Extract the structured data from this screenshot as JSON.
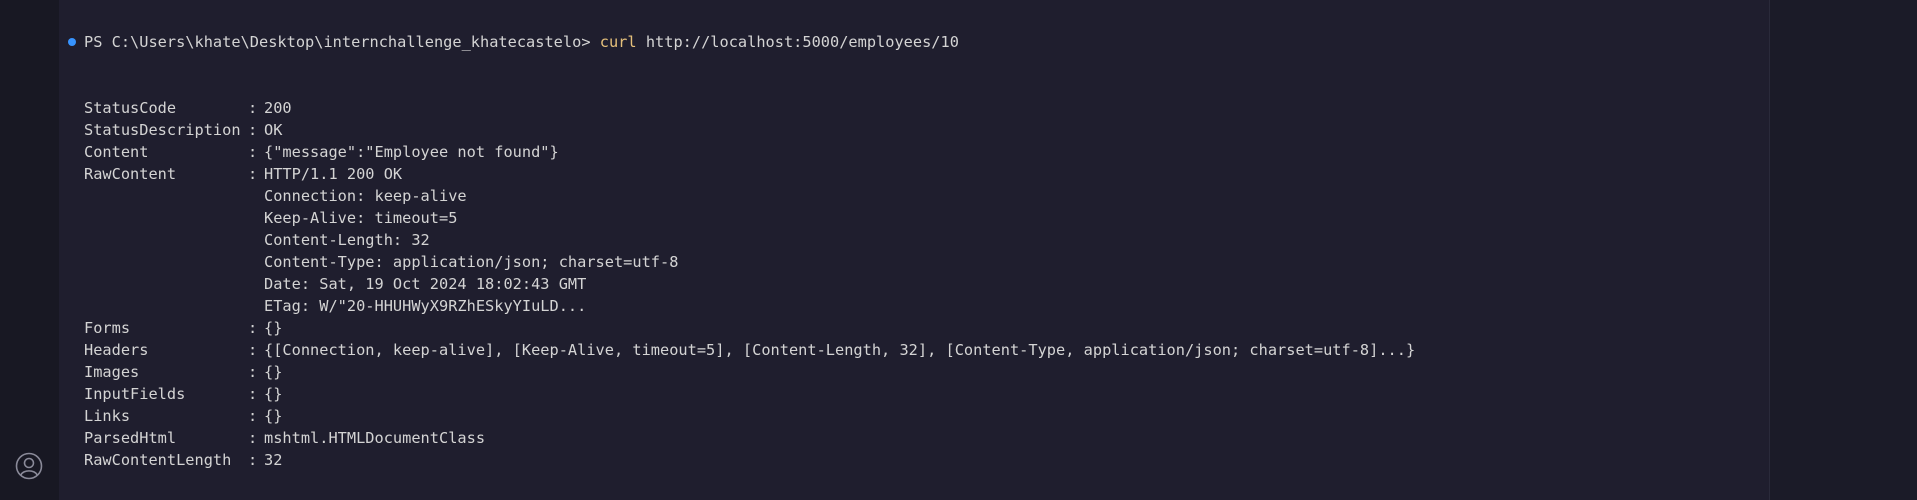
{
  "terminal": {
    "prompt": "PS C:\\Users\\khate\\Desktop\\internchallenge_khatecastelo>",
    "command": "curl",
    "args": "http://localhost:5000/employees/10",
    "output": [
      {
        "key": "StatusCode",
        "sep": ":",
        "value": "200"
      },
      {
        "key": "StatusDescription",
        "sep": ":",
        "value": "OK"
      },
      {
        "key": "Content",
        "sep": ":",
        "value": "{\"message\":\"Employee not found\"}"
      },
      {
        "key": "RawContent",
        "sep": ":",
        "value": "HTTP/1.1 200 OK"
      },
      {
        "key": "",
        "sep": "",
        "value": "Connection: keep-alive"
      },
      {
        "key": "",
        "sep": "",
        "value": "Keep-Alive: timeout=5"
      },
      {
        "key": "",
        "sep": "",
        "value": "Content-Length: 32"
      },
      {
        "key": "",
        "sep": "",
        "value": "Content-Type: application/json; charset=utf-8"
      },
      {
        "key": "",
        "sep": "",
        "value": "Date: Sat, 19 Oct 2024 18:02:43 GMT"
      },
      {
        "key": "",
        "sep": "",
        "value": "ETag: W/\"20-HHUHWyX9RZhESkyYIuLD..."
      },
      {
        "key": "Forms",
        "sep": ":",
        "value": "{}"
      },
      {
        "key": "Headers",
        "sep": ":",
        "value": "{[Connection, keep-alive], [Keep-Alive, timeout=5], [Content-Length, 32], [Content-Type, application/json; charset=utf-8]...}"
      },
      {
        "key": "Images",
        "sep": ":",
        "value": "{}"
      },
      {
        "key": "InputFields",
        "sep": ":",
        "value": "{}"
      },
      {
        "key": "Links",
        "sep": ":",
        "value": "{}"
      },
      {
        "key": "ParsedHtml",
        "sep": ":",
        "value": "mshtml.HTMLDocumentClass"
      },
      {
        "key": "RawContentLength",
        "sep": ":",
        "value": "32"
      }
    ]
  },
  "icons": {
    "account": "account-icon",
    "prompt_marker": "circle-dot-icon"
  },
  "colors": {
    "background": "#1f1e2e",
    "text": "#d4d4d4",
    "command": "#e5c07b",
    "accent": "#3794ff"
  }
}
